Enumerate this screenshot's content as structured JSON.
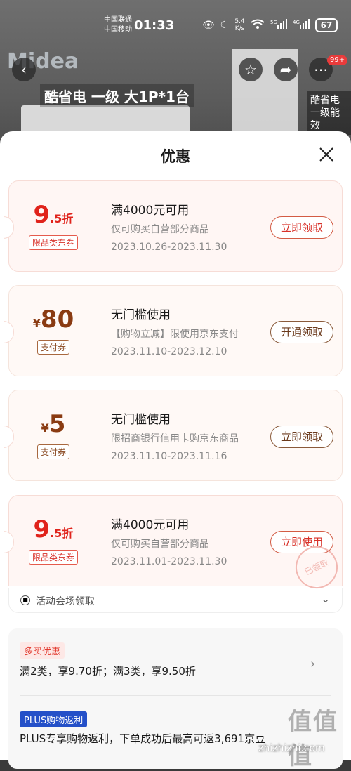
{
  "status_bar": {
    "carrier1": "中国联通",
    "carrier2": "中国移动",
    "time": "01:33",
    "speed_value": "5.4",
    "speed_unit": "K/s",
    "battery": "67"
  },
  "background": {
    "brand_logo": "Midea",
    "banner_text": "酷省电 一级 大1P*1台",
    "side_text": "酷省电 一级能效",
    "more_badge": "99+"
  },
  "sheet": {
    "title": "优惠"
  },
  "coupons": [
    {
      "amount_main": "9",
      "amount_suffix": ".5折",
      "tag": "限品类东券",
      "title": "满4000元可用",
      "desc": "仅可购买自营部分商品",
      "date": "2023.10.26-2023.11.30",
      "button": "立即领取"
    },
    {
      "amount_prefix": "¥",
      "amount_main": "80",
      "tag": "支付券",
      "title": "无门槛使用",
      "desc": "【购物立减】限使用京东支付",
      "date": "2023.11.10-2023.12.10",
      "button": "开通领取"
    },
    {
      "amount_prefix": "¥",
      "amount_main": "5",
      "tag": "支付券",
      "title": "无门槛使用",
      "desc": "限招商银行信用卡购京东商品",
      "date": "2023.11.10-2023.11.16",
      "button": "立即领取"
    },
    {
      "amount_main": "9",
      "amount_suffix": ".5折",
      "tag": "限品类东券",
      "title": "满4000元可用",
      "desc": "仅可购买自营部分商品",
      "date": "2023.11.01-2023.11.30",
      "button": "立即使用",
      "stamp": "已领取"
    }
  ],
  "venue": {
    "label": "活动会场领取"
  },
  "promotions": {
    "multi_tag": "多买优惠",
    "multi_text": "满2类，享9.70折；满3类，享9.50折",
    "plus_tag": "PLUS购物返利",
    "plus_text": "PLUS专享购物返利，下单成功后最高可返3,691京豆"
  },
  "watermark": {
    "text": "值值值",
    "url": "zhizhizhi.com"
  }
}
